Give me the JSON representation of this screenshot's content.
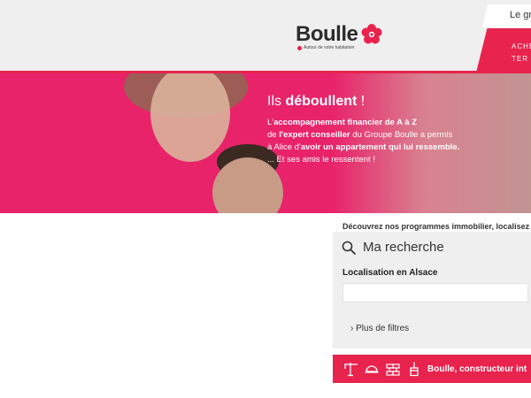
{
  "header": {
    "logo_word": "Boulle",
    "logo_tagline": "Autour de votre habitation",
    "top_right_text": "Le gr",
    "nav": [
      "ACHE",
      "TER"
    ]
  },
  "hero": {
    "title_prefix": "Ils ",
    "title_bold": "déboullent",
    "title_suffix": " !",
    "line1": {
      "a": "L'",
      "b": "accompagnement financier de A à Z"
    },
    "line2": {
      "a": "de ",
      "b": "l'expert conseiller",
      "c": " du Groupe Boulle a permis"
    },
    "line3": {
      "a": "à Alice d'",
      "b": "avoir un appartement qui lui ressemble."
    },
    "line4": "... Et ses amis le ressentent !"
  },
  "search": {
    "intro": "Découvrez nos programmes immobilier, localisez",
    "title": "Ma recherche",
    "location_label": "Localisation en Alsace",
    "location_value": "",
    "more_filters": "Plus de filtres"
  },
  "banner": {
    "text": "Boulle, constructeur int",
    "icons": [
      "crane-icon",
      "hardhat-icon",
      "bricks-icon",
      "paint-brush-icon"
    ]
  },
  "colors": {
    "brand": "#e8234d",
    "hero_bg": "#e8236a",
    "header_bg": "#efefef"
  }
}
